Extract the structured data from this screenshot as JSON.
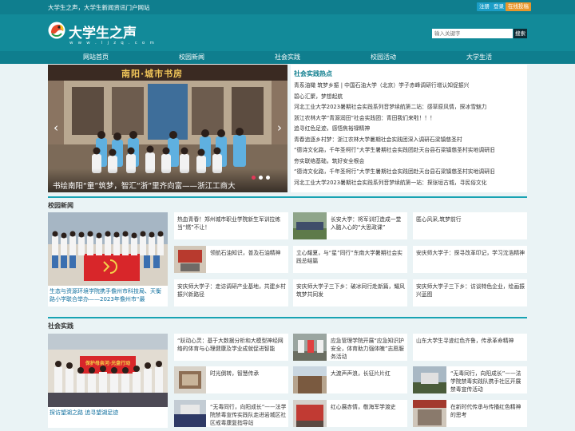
{
  "topbar": {
    "slogan": "大学生之声，大学生新闻资讯门户网站",
    "register": "注册",
    "login": "登录",
    "submit": "在线投稿"
  },
  "header": {
    "logo_name": "大学生之声",
    "logo_domain": "w w w . l j z q . c o m",
    "search_placeholder": "输入关键字",
    "search_button": "搜索"
  },
  "nav": {
    "items": [
      "网站首页",
      "校园新闻",
      "社会实践",
      "校园活动",
      "大学生活"
    ]
  },
  "slider": {
    "sign": "南阳·城市书房",
    "caption": "书绘南阳“童”筑梦，智汇“浙”里齐向富——浙江工商大",
    "prev": "‹",
    "next": "›"
  },
  "hot": {
    "title": "社会实践热点",
    "items": [
      "青系油橄 筑梦乡振 | 中国石油大学（北京）学子赤峰调研行增认知促振兴",
      "碧心汇聚，梦想起航",
      "河北工业大学2023暑期社会实践系列音梦续航第二站：感草原风情，探冰雪魅力",
      "浙江农林大学“青源润田”社会实践团：青田我们来啦！！！",
      "追寻红色足迹，感悟焦裕禄精神",
      "青春追逐乡村梦：浙江农林大学暑期社会实践团深入调研石梁镇慈圣村",
      "“德诗文化路，千年圣柯行”大学生暑期社会实践团赴天台县石梁镇慈圣村实地调研旧",
      "夯实联络基础，筑好安全根会",
      "“德诗文化路，千年圣柯行”大学生暑期社会实践团赴天台县石梁镇慈圣村实地调研旧",
      "河北工业大学2023暑期社会实践系列音梦续航第一站：探张垣古城，寻民俗文化"
    ]
  },
  "campus": {
    "title": "校园新闻",
    "big_caption": "生态与资源环境学院携手儋州市科技局、天衡路小学联合举办——2023年儋州市“最",
    "col1": [
      "热血青春！郑州城市职业学院新生军训拉练当“燃”不让！",
      "领航石油知识，普及石油精神",
      "安庆师大学子：走访调研产业基地，共建乡村振兴新路径"
    ],
    "col2": [
      "长安大学：将军训打造成一堂入脑入心的“大思政课”",
      "立心耀夏，与“星”同行”东南大学暑期社会实践总结篇",
      "安庆师大学子三下乡：破冰同行赴新篇，耀风筑梦共同发"
    ],
    "col3": [
      "匿心风采,筑梦前行",
      "安庆师大学子：探寻改革印记，学习沈浩精神",
      "安庆师大学子三下乡：访谈特色企业，绘画振兴蓝图"
    ]
  },
  "social": {
    "title": "社会实践",
    "big_caption": "探访望湖之路 追寻望湖足迹",
    "banner": "保护母亲河·光盘行动",
    "col1": [
      "“跃动心灵：基于大数据分析和大模型神经网络的体育与心理健康及学业成就促进智能",
      "时光倒转，智慧传承",
      "“无毒同行，向阳成长”——法学院禁毒宣传实践队走进岩城区社区戒毒康复指导站"
    ],
    "col2": [
      "应急管理学院开展“应急知识护安全，体育助力强体魄”志愿服务活动",
      "大渡声声浪，长征片片红",
      "红心展赤情，敬海军学渡史"
    ],
    "col3": [
      "山东大学生寻迹红色齐鲁，传承革命精神",
      "“无毒同行，向阳成长”——法学院禁毒实践队携手社区开展禁毒宣传活动",
      "在新时代传承与传播红色精神的思考"
    ]
  },
  "colors": {
    "teal_dark": "#0f7e8e",
    "teal": "#128a99",
    "accent": "#e23a5a"
  }
}
